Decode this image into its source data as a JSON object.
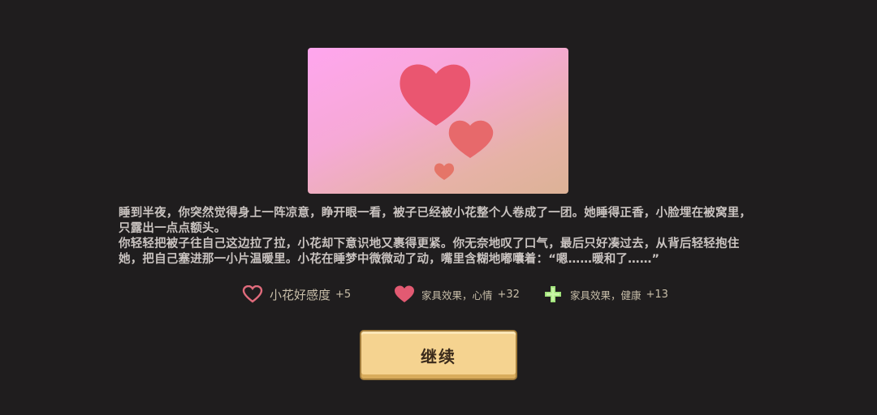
{
  "event": {
    "paragraphs": [
      "睡到半夜，你突然觉得身上一阵凉意，睁开眼一看，被子已经被小花整个人卷成了一团。她睡得正香，小脸埋在被窝里，只露出一点点额头。",
      "你轻轻把被子往自己这边拉了拉，小花却下意识地又裹得更紧。你无奈地叹了口气，最后只好凑过去，从背后轻轻抱住她，把自己塞进那一小片温暖里。小花在睡梦中微微动了动，嘴里含糊地嘟囔着：“嗯……暖和了……”"
    ]
  },
  "rewards": [
    {
      "icon": "heart-outline-icon",
      "label": "小花好感度",
      "value": "+5",
      "color": "#e06b7c"
    },
    {
      "icon": "heart-filled-icon",
      "label": "家具效果，心情",
      "value": "+32",
      "color": "#e25a72"
    },
    {
      "icon": "health-cross-icon",
      "label": "家具效果，健康",
      "value": "+13",
      "color": "#9fe07a"
    }
  ],
  "continue_button": {
    "label": "继续"
  },
  "colors": {
    "background": "#1f1d1e",
    "text": "#c9c3c0",
    "button": "#f5d390"
  }
}
